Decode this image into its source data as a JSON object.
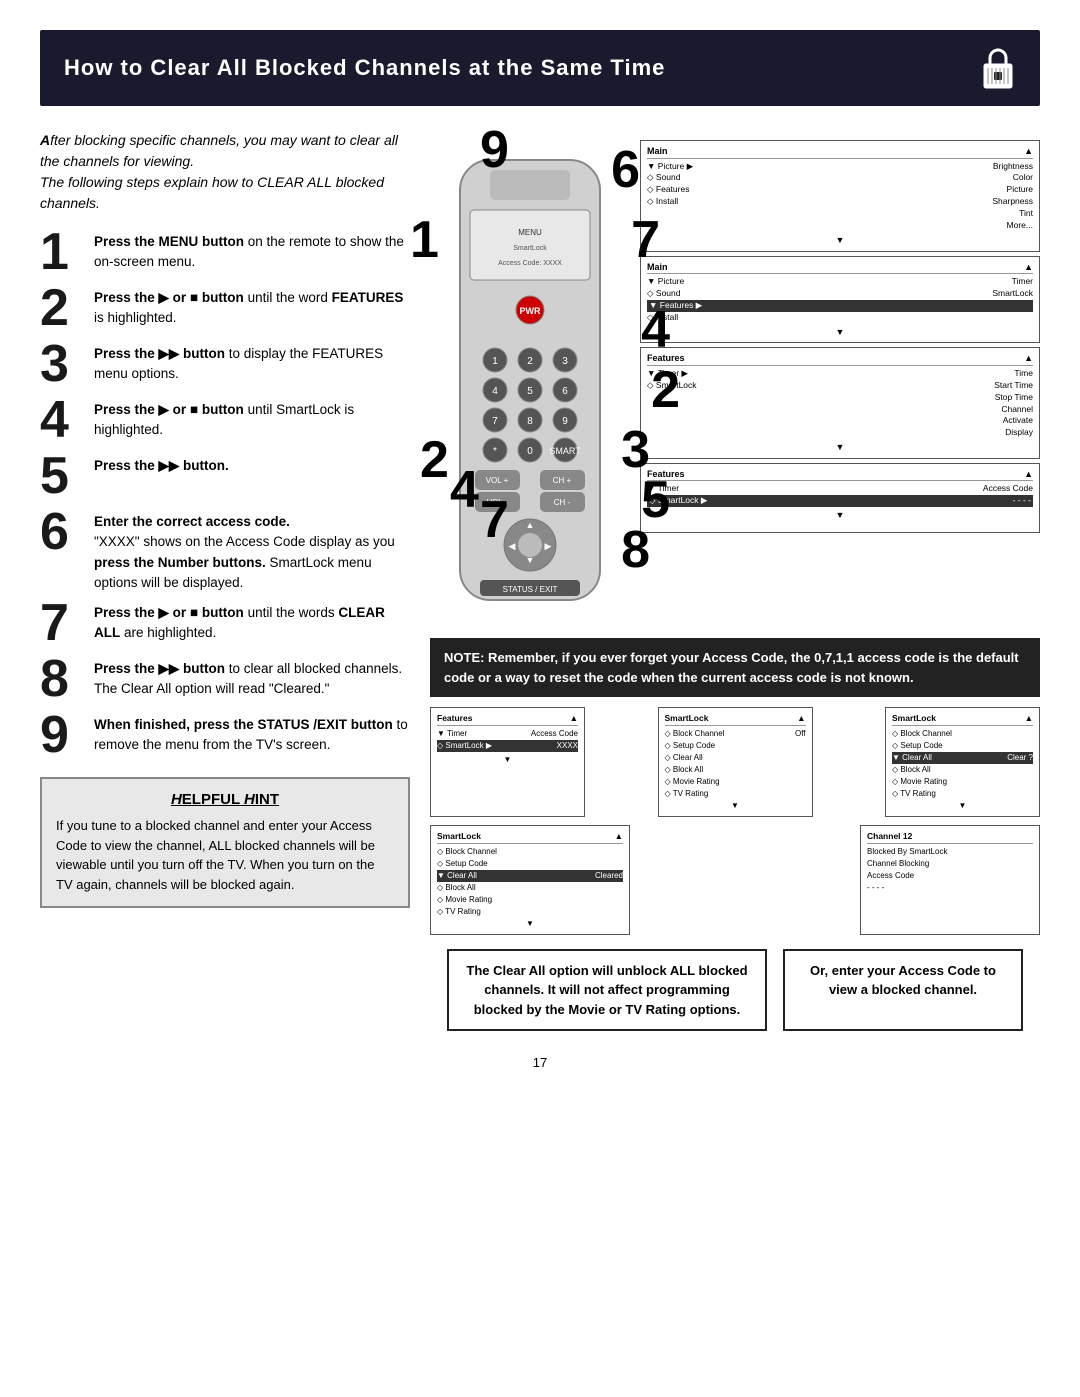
{
  "header": {
    "title": "How to Clear All Blocked Channels at the Same Time"
  },
  "intro": {
    "text1": "fter blocking specific channels, you may want to clear all the channels for viewing.",
    "text2": "The following steps explain how to CLEAR ALL blocked channels."
  },
  "steps": [
    {
      "number": "1",
      "html": "Press the <b>MENU button</b> on the remote to show the on-screen menu."
    },
    {
      "number": "2",
      "html": "Press the ▶ or ■ <b>button</b> until the word <b>FEATURES</b> is highlighted."
    },
    {
      "number": "3",
      "html": "Press the ▶▶ <b>button</b> to display the FEATURES menu options."
    },
    {
      "number": "4",
      "html": "Press the ▶ or ■ <b>button</b> until SmartLock is highlighted."
    },
    {
      "number": "5",
      "html": "Press the ▶▶ <b>button.</b>"
    },
    {
      "number": "6",
      "html": "Enter the correct access code.<br>\"XXXX\" shows on the Access Code display as you <b>press the Number buttons.</b> SmartLock menu options will be displayed."
    },
    {
      "number": "7",
      "html": "Press the ▶ or ■ <b>button</b> until the words <b>CLEAR ALL</b> are highlighted."
    },
    {
      "number": "8",
      "html": "Press the ▶▶ <b>button</b> to clear all blocked channels. The Clear All option will read \"Cleared.\""
    },
    {
      "number": "9",
      "html": "When finished, press the <b>STATUS /EXIT button</b> to remove the menu from the TV's screen."
    }
  ],
  "helpful_hint": {
    "title": "Helpful Hint",
    "text": "If you tune to a blocked channel and enter your Access Code to view the channel, ALL blocked channels will be viewable until you turn off the TV. When you turn on the TV again, channels will be blocked again."
  },
  "note": {
    "text": "NOTE: Remember, if you ever forget your Access Code, the 0,7,1,1 access code is the default code or a way to reset the code when the current access code is not known."
  },
  "screens": {
    "panel1": {
      "title": "Main",
      "rows": [
        "▼ Picture  ▶  Brightness",
        "◇ Sound       Color",
        "◇ Features    Picture",
        "◇ Install      Sharpness",
        "               Tint",
        "               More..."
      ]
    },
    "panel2": {
      "title": "Main",
      "rows": [
        "▼ Picture     Timer",
        "◇ Sound       SmartLock",
        "▼ Features  ▶",
        "◇ Install"
      ]
    },
    "panel3": {
      "title": "Features",
      "rows": [
        "▼ Timer    ▶  Time",
        "◇ SmartLock   Start Time",
        "              Stop Time",
        "              Channel",
        "              Activate",
        "              Display"
      ]
    },
    "panel4": {
      "title": "Features",
      "rows": [
        "▼ Timer       Access Code",
        "◇ SmartLock  ▶  - - - -"
      ]
    },
    "panel5": {
      "title": "Features",
      "rows": [
        "▼ Timer       Access Code",
        "◇ SmartLock  ▶  XXXX"
      ]
    },
    "panel6": {
      "title": "SmartLock",
      "rows": [
        "◇ Block Channel  Off",
        "◇ Setup Code",
        "◇ Clear All",
        "◇ Block All",
        "◇ Movie Rating",
        "◇ TV Rating"
      ]
    },
    "panel7": {
      "title": "SmartLock",
      "rows": [
        "◇ Block Channel",
        "◇ Setup Code",
        "▼ Clear All    Clear ?",
        "◇ Block All",
        "◇ Movie Rating",
        "◇ TV Rating"
      ]
    },
    "panel8_left": {
      "title": "SmartLock",
      "rows": [
        "◇ Block Channel",
        "◇ Setup Code",
        "▼ Clear All   Cleared",
        "◇ Block All",
        "◇ Movie Rating",
        "◇ TV Rating"
      ]
    },
    "panel8_right": {
      "title": "Channel 12",
      "rows": [
        "Blocked By SmartLock",
        "Channel Blocking",
        "Access Code",
        "- - - -"
      ]
    }
  },
  "captions": {
    "bottom_left": "The Clear All option will unblock ALL blocked channels. It will not affect programming blocked by the Movie or TV Rating options.",
    "bottom_right": "Or, enter your Access Code to view a blocked channel."
  },
  "page_number": "17"
}
